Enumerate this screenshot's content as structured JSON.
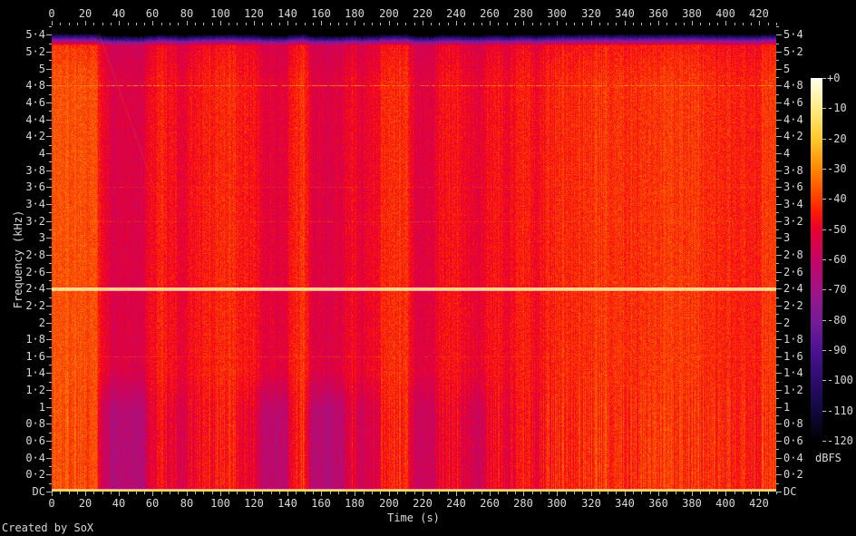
{
  "footer": {
    "credit": "Created by SoX"
  },
  "axes": {
    "x": {
      "title": "Time (s)",
      "ticks": [
        0,
        20,
        40,
        60,
        80,
        100,
        120,
        140,
        160,
        180,
        200,
        220,
        240,
        260,
        280,
        300,
        320,
        340,
        360,
        380,
        400,
        420
      ],
      "major_step": 20,
      "minor_step": 5
    },
    "y": {
      "title": "Frequency (kHz)",
      "ticks": [
        {
          "value": 5.4,
          "label": "5·4"
        },
        {
          "value": 5.2,
          "label": "5·2"
        },
        {
          "value": 5,
          "label": "5"
        },
        {
          "value": 4.8,
          "label": "4·8"
        },
        {
          "value": 4.6,
          "label": "4·6"
        },
        {
          "value": 4.4,
          "label": "4·4"
        },
        {
          "value": 4.2,
          "label": "4·2"
        },
        {
          "value": 4,
          "label": "4"
        },
        {
          "value": 3.8,
          "label": "3·8"
        },
        {
          "value": 3.6,
          "label": "3·6"
        },
        {
          "value": 3.4,
          "label": "3·4"
        },
        {
          "value": 3.2,
          "label": "3·2"
        },
        {
          "value": 3,
          "label": "3"
        },
        {
          "value": 2.8,
          "label": "2·8"
        },
        {
          "value": 2.6,
          "label": "2·6"
        },
        {
          "value": 2.4,
          "label": "2·4"
        },
        {
          "value": 2.2,
          "label": "2·2"
        },
        {
          "value": 2,
          "label": "2"
        },
        {
          "value": 1.8,
          "label": "1·8"
        },
        {
          "value": 1.6,
          "label": "1·6"
        },
        {
          "value": 1.4,
          "label": "1·4"
        },
        {
          "value": 1.2,
          "label": "1·2"
        },
        {
          "value": 1,
          "label": "1"
        },
        {
          "value": 0.8,
          "label": "0·8"
        },
        {
          "value": 0.6,
          "label": "0·6"
        },
        {
          "value": 0.4,
          "label": "0·4"
        },
        {
          "value": 0.2,
          "label": "0·2"
        },
        {
          "value": 0,
          "label": "DC"
        }
      ],
      "minor_step": 0.1
    },
    "colorbar": {
      "title": "dBFS",
      "ticks": [
        "+0",
        "-10",
        "-20",
        "-30",
        "-40",
        "-50",
        "-60",
        "-70",
        "-80",
        "-90",
        "-100",
        "-110",
        "-120"
      ]
    }
  },
  "chart_data": {
    "type": "heatmap",
    "subtype": "audio-spectrogram",
    "x_range_s": [
      0,
      430
    ],
    "y_range_khz": [
      0,
      5.5125
    ],
    "z_range_dbfs": [
      -120,
      0
    ],
    "colormap_stops": [
      [
        -120,
        0,
        0,
        0
      ],
      [
        -110,
        18,
        8,
        62
      ],
      [
        -100,
        44,
        12,
        108
      ],
      [
        -90,
        76,
        18,
        148
      ],
      [
        -80,
        118,
        28,
        150
      ],
      [
        -70,
        160,
        20,
        135
      ],
      [
        -60,
        196,
        5,
        100
      ],
      [
        -50,
        232,
        0,
        50
      ],
      [
        -45,
        252,
        20,
        10
      ],
      [
        -40,
        255,
        60,
        0
      ],
      [
        -30,
        255,
        135,
        0
      ],
      [
        -20,
        255,
        200,
        45
      ],
      [
        -10,
        255,
        235,
        130
      ],
      [
        0,
        255,
        255,
        235
      ]
    ],
    "low_band_khz": 1.45,
    "time_bands": [
      [
        0,
        27.5,
        -37,
        -37
      ],
      [
        27.5,
        33,
        -47,
        -54
      ],
      [
        33,
        56,
        -54,
        -65
      ],
      [
        56,
        63,
        -47,
        -50
      ],
      [
        63,
        67,
        -42,
        -44
      ],
      [
        67,
        75,
        -47,
        -51
      ],
      [
        75,
        80,
        -51,
        -55
      ],
      [
        80,
        90,
        -46,
        -48
      ],
      [
        90,
        98,
        -44,
        -46
      ],
      [
        98,
        110,
        -42,
        -43
      ],
      [
        110,
        123,
        -46,
        -51
      ],
      [
        123,
        140,
        -52,
        -63
      ],
      [
        140,
        147,
        -44,
        -46
      ],
      [
        147,
        152,
        -41,
        -42
      ],
      [
        152,
        174,
        -53,
        -64
      ],
      [
        174,
        180,
        -47,
        -49
      ],
      [
        180,
        187,
        -51,
        -57
      ],
      [
        187,
        195,
        -48,
        -53
      ],
      [
        195,
        213,
        -42,
        -43
      ],
      [
        213,
        229,
        -53,
        -59
      ],
      [
        229,
        243,
        -45,
        -47
      ],
      [
        243,
        259,
        -50,
        -56
      ],
      [
        259,
        267,
        -45,
        -46
      ],
      [
        267,
        274,
        -49,
        -52
      ],
      [
        274,
        284,
        -44,
        -45
      ],
      [
        284,
        291,
        -48,
        -50
      ],
      [
        291,
        300,
        -44,
        -44
      ],
      [
        300,
        320,
        -42,
        -42
      ],
      [
        320,
        342,
        -41,
        -41
      ],
      [
        342,
        362,
        -42,
        -42
      ],
      [
        362,
        386,
        -40,
        -40
      ],
      [
        386,
        396,
        -43,
        -43
      ],
      [
        396,
        421,
        -44,
        -44
      ],
      [
        421,
        430,
        -40,
        -40
      ]
    ],
    "tonal_lines": [
      {
        "freq_khz": 2.4,
        "level_db": -15,
        "halo": true,
        "jitter_db": 8,
        "dropout": 0,
        "alpha": 1
      },
      {
        "freq_khz": 4.8,
        "level_db": -31,
        "halo": false,
        "jitter_db": 8,
        "dropout": 0.3,
        "alpha": 0.85
      },
      {
        "freq_khz": 3.6,
        "level_db": -37,
        "halo": false,
        "jitter_db": 6,
        "dropout": 0.55,
        "alpha": 0.45
      },
      {
        "freq_khz": 3.2,
        "level_db": -37,
        "halo": false,
        "jitter_db": 6,
        "dropout": 0.5,
        "alpha": 0.5
      },
      {
        "freq_khz": 1.6,
        "level_db": -37,
        "halo": false,
        "jitter_db": 6,
        "dropout": 0.5,
        "alpha": 0.5
      }
    ],
    "dc_line": {
      "level_db": -15,
      "rows": 2
    },
    "nyquist_rolloff": {
      "start_khz": 5.28,
      "full_khz": 5.5125,
      "max_atten_db": 126
    },
    "high_shade": {
      "start_khz": 4.85,
      "db_per_khz": 8
    },
    "scratches": [
      {
        "from": [
          28,
          5.42
        ],
        "to": [
          68,
          3.2
        ]
      },
      {
        "from": [
          76,
          3.66
        ],
        "to": [
          124,
          2.84
        ]
      }
    ]
  }
}
